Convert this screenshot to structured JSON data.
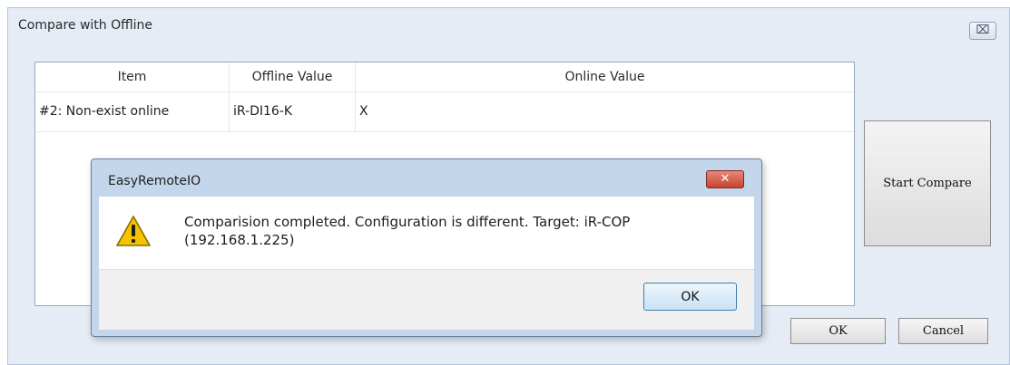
{
  "window": {
    "title": "Compare with Offline",
    "close_label": "⌧"
  },
  "table": {
    "columns": [
      "Item",
      "Offline Value",
      "Online Value"
    ],
    "rows": [
      [
        "#2: Non-exist online",
        "iR-DI16-K",
        "X"
      ]
    ]
  },
  "buttons": {
    "start_compare": "Start Compare",
    "ok": "OK",
    "cancel": "Cancel"
  },
  "message_box": {
    "title": "EasyRemoteIO",
    "close_label": "✕",
    "line1": "Comparision completed. Configuration is different. Target: iR-COP",
    "line2": "(192.168.1.225)",
    "ok": "OK",
    "icon": "warning-icon"
  },
  "colors": {
    "window_bg": "#e6ecf5",
    "msgbox_frame": "#c4d6ec",
    "close_red": "#c9432f",
    "warning_yellow": "#f5c400"
  }
}
